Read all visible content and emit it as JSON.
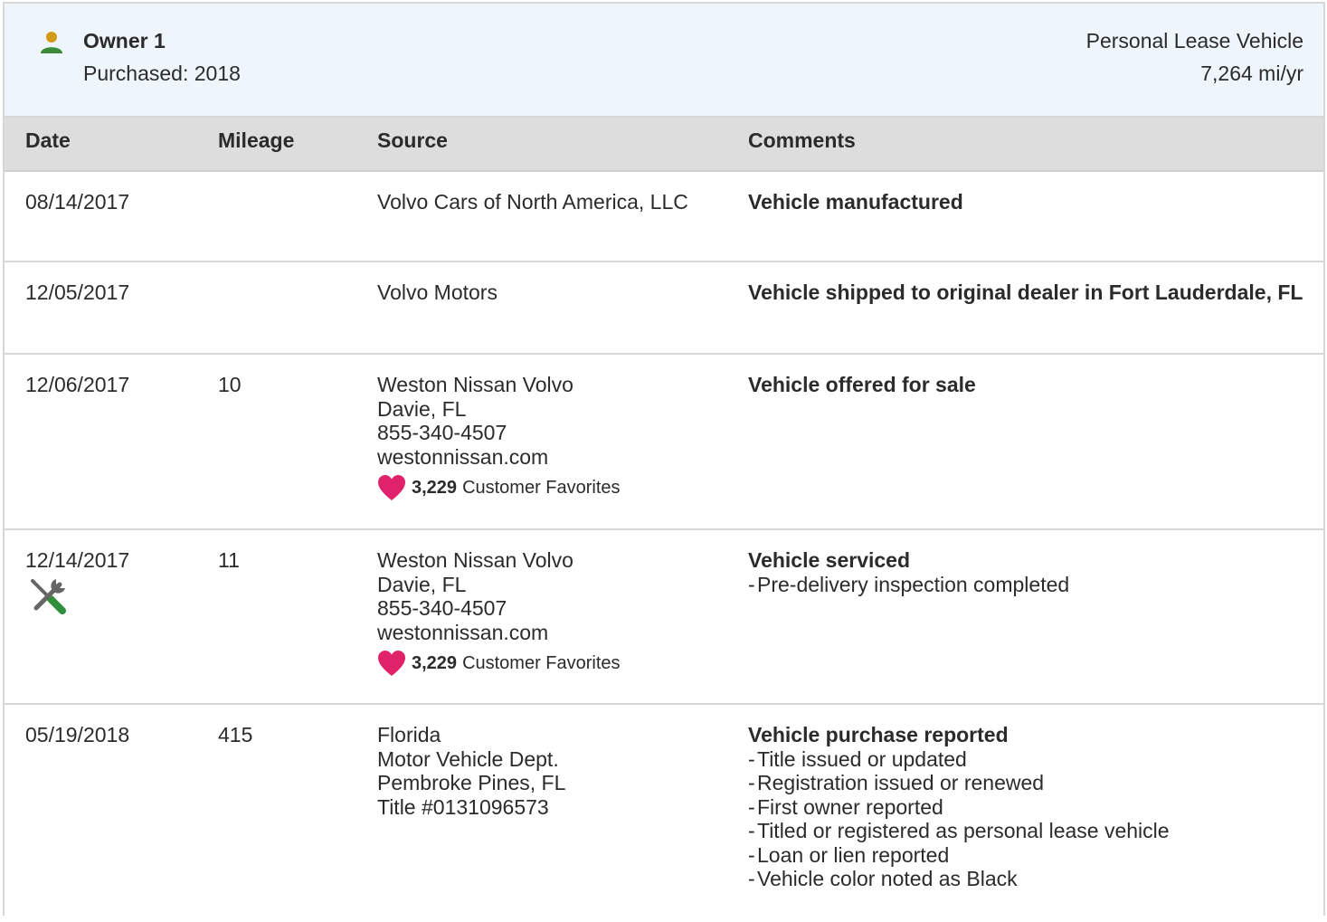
{
  "owner": {
    "name": "Owner 1",
    "purchased": "Purchased: 2018",
    "type": "Personal Lease Vehicle",
    "miles_per_year": "7,264 mi/yr"
  },
  "table": {
    "headers": {
      "date": "Date",
      "mileage": "Mileage",
      "source": "Source",
      "comments": "Comments"
    },
    "rows": [
      {
        "date": "08/14/2017",
        "mileage": "",
        "source": [
          "Volvo Cars of North America, LLC"
        ],
        "comment_title": "Vehicle manufactured",
        "comment_items": []
      },
      {
        "date": "12/05/2017",
        "mileage": "",
        "source": [
          "Volvo Motors"
        ],
        "comment_title": "Vehicle shipped to original dealer in Fort Lauderdale, FL",
        "comment_items": []
      },
      {
        "date": "12/06/2017",
        "mileage": "10",
        "source": [
          "Weston Nissan Volvo",
          "Davie, FL",
          "855-340-4507",
          "westonnissan.com"
        ],
        "favorites_count": "3,229",
        "favorites_label": "Customer Favorites",
        "comment_title": "Vehicle offered for sale",
        "comment_items": []
      },
      {
        "date": "12/14/2017",
        "mileage": "11",
        "source": [
          "Weston Nissan Volvo",
          "Davie, FL",
          "855-340-4507",
          "westonnissan.com"
        ],
        "favorites_count": "3,229",
        "favorites_label": "Customer Favorites",
        "comment_title": "Vehicle serviced",
        "comment_items": [
          "Pre-delivery inspection completed"
        ]
      },
      {
        "date": "05/19/2018",
        "mileage": "415",
        "source": [
          "Florida",
          "Motor Vehicle Dept.",
          "Pembroke Pines, FL",
          "Title #0131096573"
        ],
        "comment_title": "Vehicle purchase reported",
        "comment_items": [
          "Title issued or updated",
          "Registration issued or renewed",
          "First owner reported",
          "Titled or registered as personal lease vehicle",
          "Loan or lien reported",
          "Vehicle color noted as Black"
        ]
      }
    ]
  },
  "icons": {
    "owner": "person-icon",
    "favorite": "heart-icon",
    "service": "wrench-screwdriver-icon"
  },
  "colors": {
    "header_bg": "#eef5fb",
    "table_head_bg": "#dddddd",
    "heart": "#e0226b",
    "person_head": "#d29a17",
    "person_body": "#3a8a3a",
    "service_green": "#2f8f3a"
  }
}
